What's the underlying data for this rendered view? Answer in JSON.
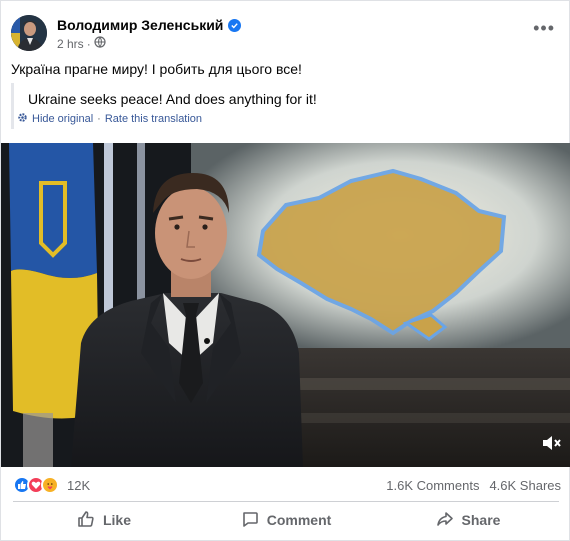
{
  "post": {
    "author": "Володимир Зеленський",
    "time": "2 hrs",
    "text": "Україна прагне миру! І робить для цього все!",
    "translation": "Ukraine seeks peace! And does anything for it!",
    "hide_original": "Hide original",
    "separator": "·",
    "rate_translation": "Rate this translation"
  },
  "stats": {
    "reactions_count": "12K",
    "comments": "1.6K Comments",
    "shares": "4.6K Shares"
  },
  "actions": {
    "like": "Like",
    "comment": "Comment",
    "share": "Share"
  },
  "colors": {
    "accent": "#1877f2",
    "link": "#385898",
    "secondary_text": "#65676b"
  },
  "icons": [
    "verified-badge-icon",
    "globe-icon",
    "more-options-icon",
    "gear-icon",
    "like-reaction-icon",
    "love-reaction-icon",
    "care-reaction-icon",
    "mute-icon",
    "like-icon",
    "comment-icon",
    "share-icon"
  ]
}
